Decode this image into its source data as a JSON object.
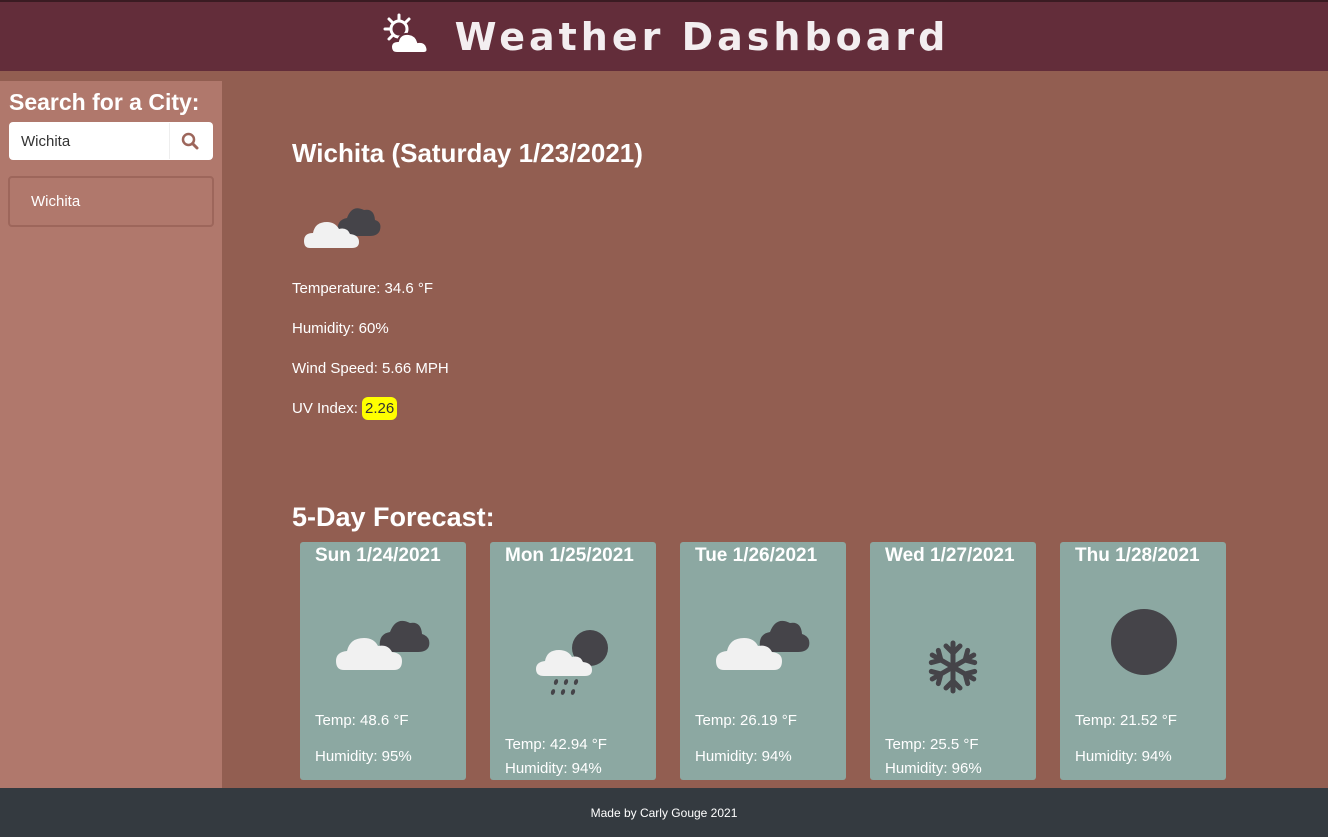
{
  "header": {
    "title": "Weather Dashboard",
    "logo_icon": "sun-behind-cloud-icon"
  },
  "sidebar": {
    "heading": "Search for a City:",
    "search": {
      "value": "Wichita",
      "icon": "search-icon"
    },
    "history": [
      "Wichita"
    ]
  },
  "current": {
    "title": "Wichita (Saturday 1/23/2021)",
    "icon": "broken-clouds-icon",
    "temperature": "Temperature: 34.6 °F",
    "humidity": "Humidity: 60%",
    "wind": "Wind Speed: 5.66 MPH",
    "uv_label": "UV Index:",
    "uv_value": "2.26",
    "uv_color": "#ffff00"
  },
  "forecast": {
    "title": "5-Day Forecast:",
    "days": [
      {
        "date": "Sun 1/24/2021",
        "icon": "broken-clouds-icon",
        "temp": "Temp: 48.6 °F",
        "humidity": "Humidity: 95%"
      },
      {
        "date": "Mon 1/25/2021",
        "icon": "rain-icon",
        "temp": "Temp: 42.94 °F",
        "humidity": "Humidity: 94%"
      },
      {
        "date": "Tue 1/26/2021",
        "icon": "broken-clouds-icon",
        "temp": "Temp: 26.19 °F",
        "humidity": "Humidity: 94%"
      },
      {
        "date": "Wed 1/27/2021",
        "icon": "snow-icon",
        "temp": "Temp: 25.5 °F",
        "humidity": "Humidity: 96%"
      },
      {
        "date": "Thu 1/28/2021",
        "icon": "clear-sky-icon",
        "temp": "Temp: 21.52 °F",
        "humidity": "Humidity: 94%"
      }
    ]
  },
  "footer": {
    "text": "Made by Carly Gouge 2021"
  },
  "colors": {
    "header_bg": "#632d3a",
    "sidebar_bg": "#b0786c",
    "main_bg": "#925e51",
    "card_bg": "#8ca8a2",
    "footer_bg": "#343a40"
  }
}
